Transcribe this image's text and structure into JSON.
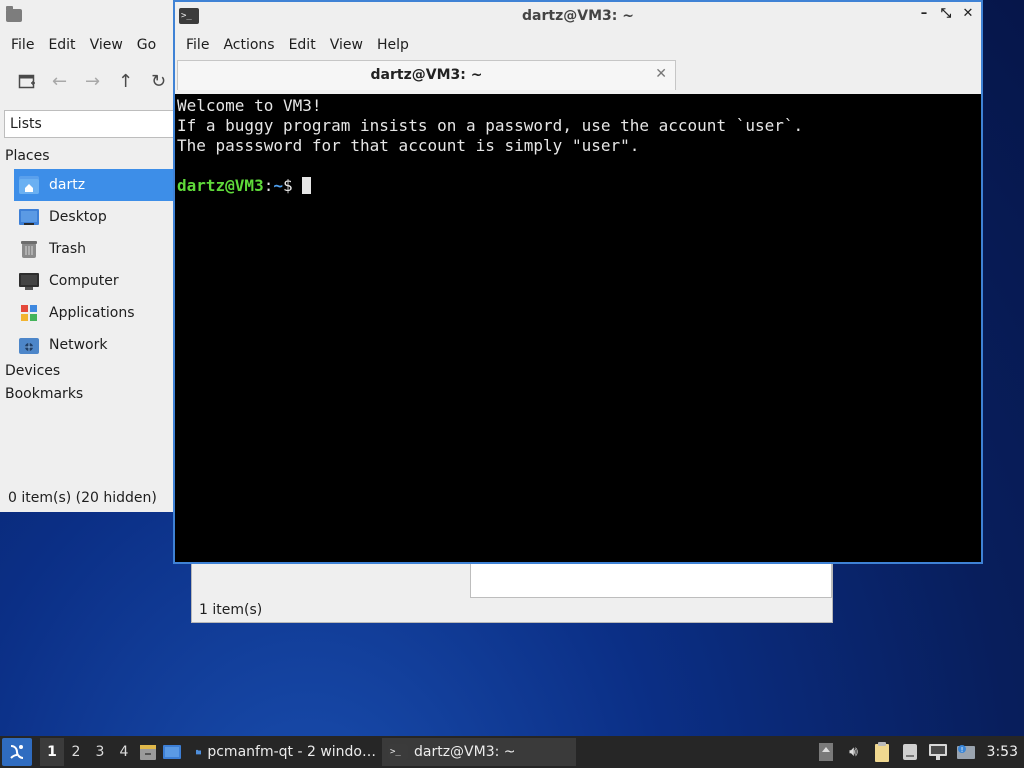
{
  "file_manager": {
    "menu": [
      "File",
      "Edit",
      "View",
      "Go"
    ],
    "side_dropdown": "Lists",
    "places_heading": "Places",
    "places": [
      {
        "label": "dartz",
        "icon": "home-folder-icon"
      },
      {
        "label": "Desktop",
        "icon": "desktop-icon"
      },
      {
        "label": "Trash",
        "icon": "trash-icon"
      },
      {
        "label": "Computer",
        "icon": "computer-icon"
      },
      {
        "label": "Applications",
        "icon": "applications-icon"
      },
      {
        "label": "Network",
        "icon": "network-icon"
      }
    ],
    "devices_heading": "Devices",
    "bookmarks_heading": "Bookmarks",
    "status": "0 item(s) (20 hidden)"
  },
  "file_manager_2": {
    "status": "1 item(s)"
  },
  "terminal": {
    "title": "dartz@VM3: ~",
    "menu": [
      "File",
      "Actions",
      "Edit",
      "View",
      "Help"
    ],
    "tab_label": "dartz@VM3: ~",
    "lines": [
      "Welcome to VM3!",
      "If a buggy program insists on a password, use the account `user`.",
      "The passsword for that account is simply \"user\"."
    ],
    "prompt_user": "dartz@VM3",
    "prompt_sep": ":",
    "prompt_path": "~",
    "prompt_symbol": "$ "
  },
  "taskbar": {
    "desktops": [
      "1",
      "2",
      "3",
      "4"
    ],
    "tasks": [
      {
        "label": "pcmanfm-qt - 2 windo…",
        "icon": "folder-icon"
      },
      {
        "label": "dartz@VM3: ~",
        "icon": "terminal-icon"
      }
    ],
    "clock": "3:53"
  },
  "colors": {
    "selection": "#3d8ee8",
    "terminal_bg": "#000000",
    "prompt_user": "#5fd93a",
    "prompt_path": "#4fa0f0",
    "active_border": "#3f82d5",
    "taskbar_bg": "#262626"
  }
}
